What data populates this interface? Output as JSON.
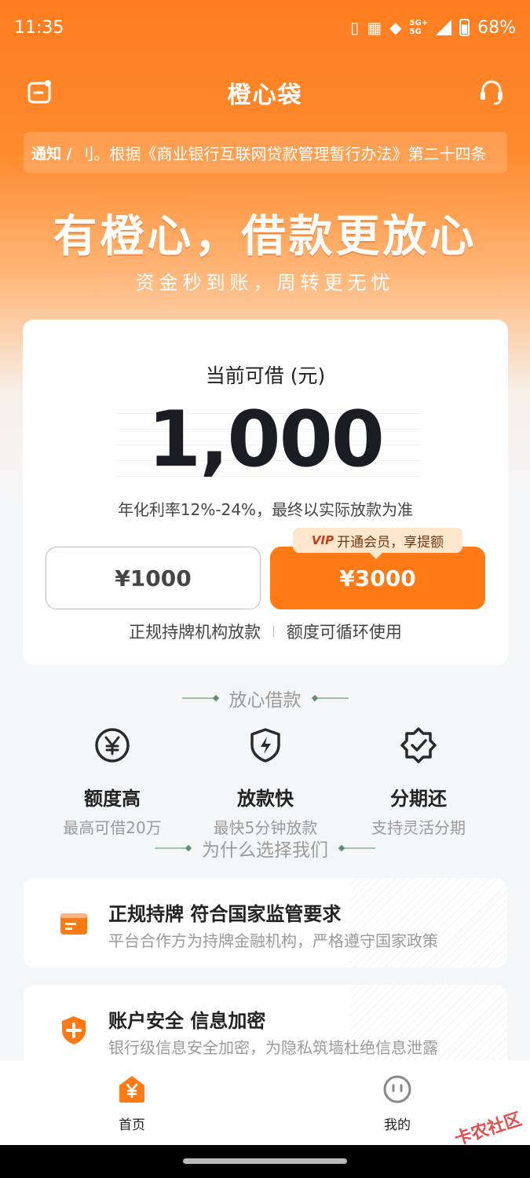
{
  "status": {
    "time": "11:35",
    "network": "5G+",
    "network2": "5G",
    "battery": "68%"
  },
  "nav": {
    "title": "橙心袋"
  },
  "notice": {
    "tag": "通知 /",
    "text": "刂。根据《商业银行互联网贷款管理暂行办法》第二十四条"
  },
  "hero": {
    "slogan": "有橙心，借款更放心",
    "subslogan": "资金秒到账，周转更无忧"
  },
  "loan_card": {
    "label": "当前可借 (元)",
    "amount": "1,000",
    "rate_note": "年化利率12%-24%，最终以实际放款为准",
    "option_1000": "¥1000",
    "option_3000": "¥3000",
    "vip_badge": "VIP",
    "vip_tip": "开通会员，享提额",
    "foot_left": "正规持牌机构放款",
    "foot_sep": "|",
    "foot_right": "额度可循环使用"
  },
  "sections": {
    "relax": "放心借款",
    "why": "为什么选择我们"
  },
  "features": [
    {
      "name": "额度高",
      "desc": "最高可借20万",
      "icon": "yen-circle-icon"
    },
    {
      "name": "放款快",
      "desc": "最快5分钟放款",
      "icon": "lightning-shield-icon"
    },
    {
      "name": "分期还",
      "desc": "支持灵活分期",
      "icon": "check-badge-icon"
    }
  ],
  "why_items": [
    {
      "title": "正规持牌 符合国家监管要求",
      "desc": "平台合作方为持牌金融机构，严格遵守国家政策",
      "icon": "license-card-icon"
    },
    {
      "title": "账户安全 信息加密",
      "desc": "银行级信息安全加密，为隐私筑墙杜绝信息泄露",
      "icon": "shield-plus-icon"
    }
  ],
  "tabs": [
    {
      "label": "首页",
      "icon": "home-yen-icon"
    },
    {
      "label": "我的",
      "icon": "smile-face-icon"
    }
  ],
  "watermark": "卡农社区",
  "colors": {
    "brand": "#ff7a14",
    "brand_light": "#ffe6cc",
    "accent_green": "#5f8f72"
  }
}
